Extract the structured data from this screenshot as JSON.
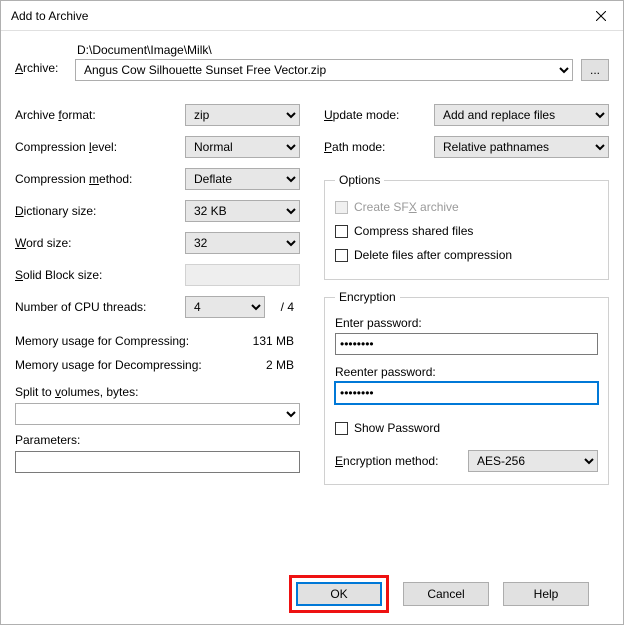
{
  "title": "Add to Archive",
  "archive": {
    "label": "Archive:",
    "path": "D:\\Document\\Image\\Milk\\",
    "file": "Angus Cow Silhouette Sunset Free Vector.zip",
    "browse": "..."
  },
  "left": {
    "format": {
      "label": "Archive format:",
      "value": "zip"
    },
    "level": {
      "label": "Compression level:",
      "value": "Normal"
    },
    "method": {
      "label": "Compression method:",
      "value": "Deflate"
    },
    "dict": {
      "label": "Dictionary size:",
      "value": "32 KB"
    },
    "word": {
      "label": "Word size:",
      "value": "32"
    },
    "solid": {
      "label": "Solid Block size:",
      "value": ""
    },
    "cpu": {
      "label": "Number of CPU threads:",
      "value": "4",
      "total": "/ 4"
    },
    "memC": {
      "label": "Memory usage for Compressing:",
      "value": "131 MB"
    },
    "memD": {
      "label": "Memory usage for Decompressing:",
      "value": "2 MB"
    },
    "split": {
      "label": "Split to volumes, bytes:",
      "value": ""
    },
    "params": {
      "label": "Parameters:",
      "value": ""
    }
  },
  "right": {
    "update": {
      "label": "Update mode:",
      "value": "Add and replace files"
    },
    "pathmode": {
      "label": "Path mode:",
      "value": "Relative pathnames"
    },
    "options": {
      "legend": "Options",
      "sfx": "Create SFX archive",
      "shared": "Compress shared files",
      "delete": "Delete files after compression"
    },
    "encryption": {
      "legend": "Encryption",
      "enter": "Enter password:",
      "reenter": "Reenter password:",
      "pw1": "••••••••",
      "pw2": "••••••••",
      "show": "Show Password",
      "method_label": "Encryption method:",
      "method": "AES-256"
    }
  },
  "buttons": {
    "ok": "OK",
    "cancel": "Cancel",
    "help": "Help"
  }
}
